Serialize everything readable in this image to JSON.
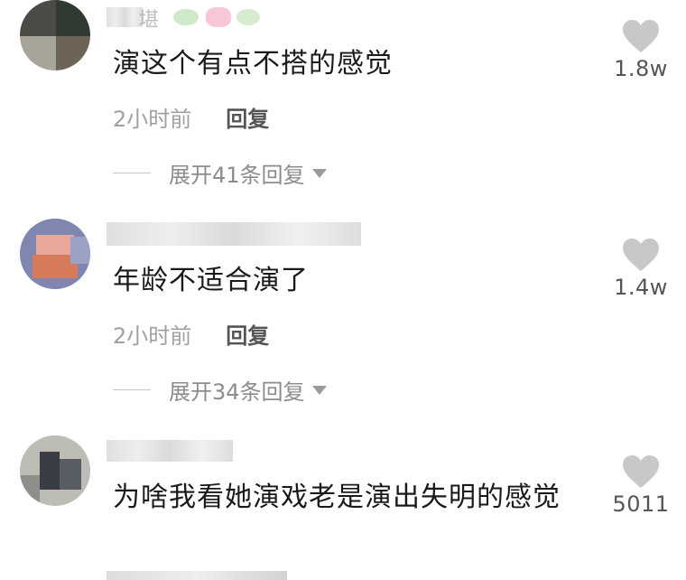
{
  "comments": [
    {
      "text": "演这个有点不搭的感觉",
      "time": "2小时前",
      "reply_label": "回复",
      "expand_label": "展开41条回复",
      "likes": "1.8w",
      "username_visible_fragment": "堪"
    },
    {
      "text": "年龄不适合演了",
      "time": "2小时前",
      "reply_label": "回复",
      "expand_label": "展开34条回复",
      "likes": "1.4w"
    },
    {
      "text": "为啥我看她演戏老是演出失明的感觉",
      "likes": "5011"
    }
  ],
  "colors": {
    "text": "#1a1a1a",
    "meta": "#a0a0a0",
    "heart": "#c8c8c8"
  },
  "icons": [
    "heart-icon",
    "caret-down-icon"
  ]
}
